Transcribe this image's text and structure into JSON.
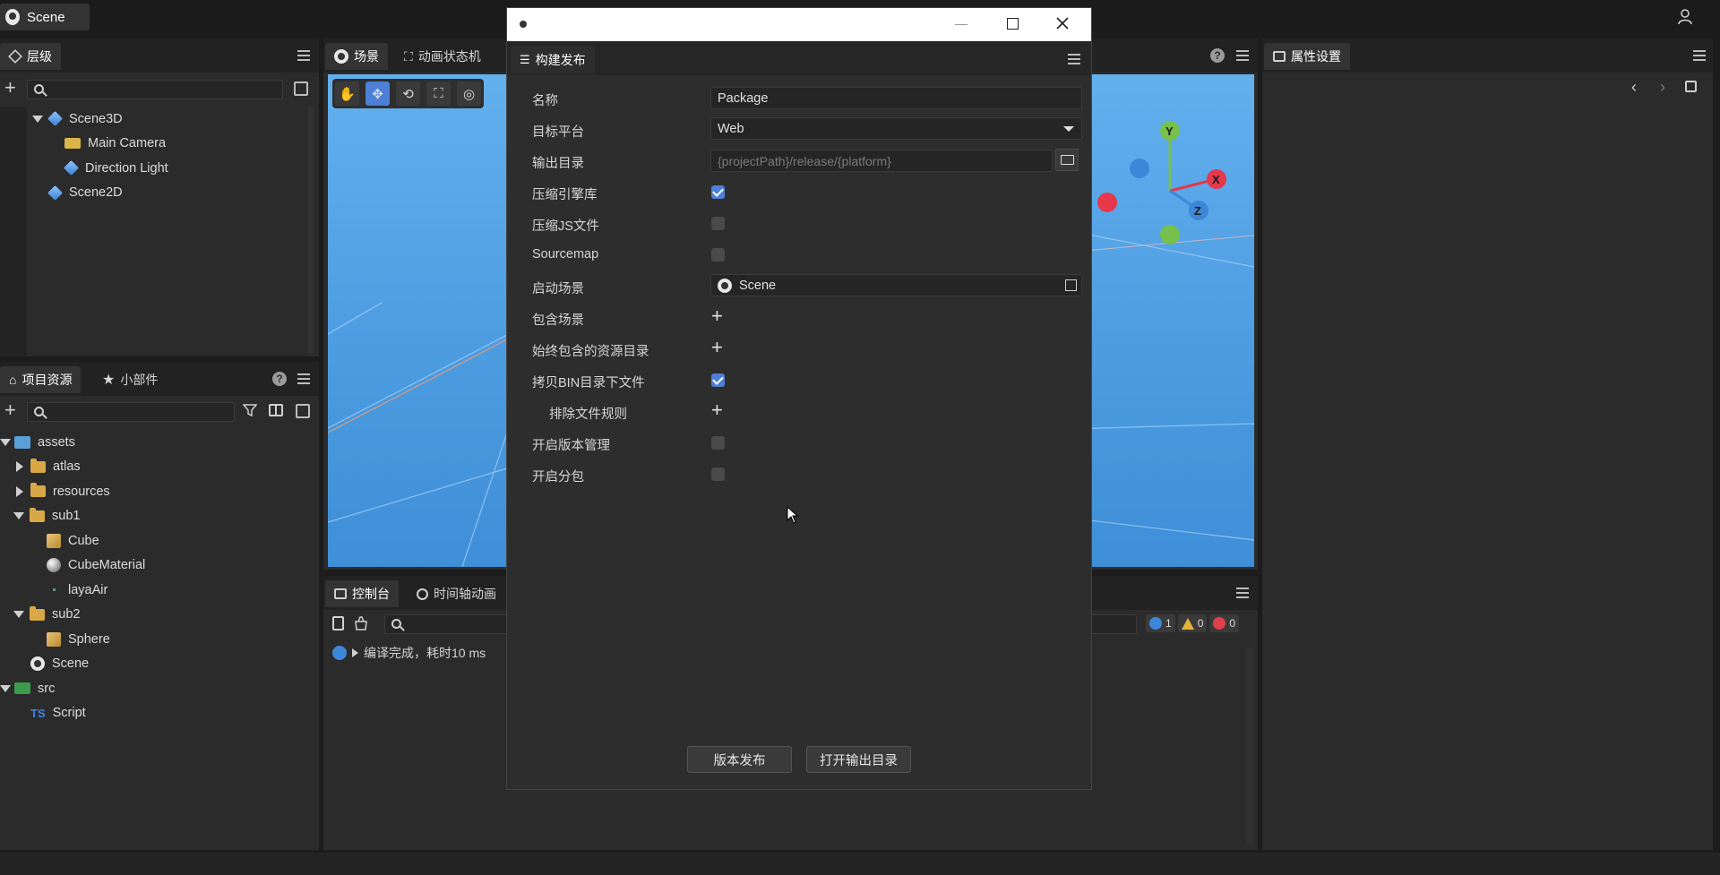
{
  "app": {
    "scene_tab": "Scene"
  },
  "hierarchy": {
    "tab_label": "层级",
    "tree": [
      {
        "label": "Scene3D",
        "icon": "cube-icon"
      },
      {
        "label": "Main Camera",
        "icon": "camera-icon"
      },
      {
        "label": "Direction Light",
        "icon": "cube-icon"
      },
      {
        "label": "Scene2D",
        "icon": "cube-icon"
      }
    ]
  },
  "assets_panel": {
    "tab_project": "项目资源",
    "tab_widgets": "小部件",
    "tree": [
      {
        "label": "assets"
      },
      {
        "label": "atlas"
      },
      {
        "label": "resources"
      },
      {
        "label": "sub1"
      },
      {
        "label": "Cube"
      },
      {
        "label": "CubeMaterial"
      },
      {
        "label": "layaAir"
      },
      {
        "label": "sub2"
      },
      {
        "label": "Sphere"
      },
      {
        "label": "Scene"
      },
      {
        "label": "src"
      },
      {
        "label": "Script",
        "prefix": "TS"
      }
    ]
  },
  "center": {
    "tab_scene": "场景",
    "tab_animator": "动画状态机",
    "gizmo_labels": {
      "y": "Y",
      "x": "X",
      "z": "Z"
    }
  },
  "console": {
    "tab_console": "控制台",
    "tab_timeline": "时间轴动画",
    "message": "编译完成，耗时10 ms",
    "counts": {
      "info": "1",
      "warn": "0",
      "error": "0"
    }
  },
  "properties": {
    "tab_label": "属性设置"
  },
  "dialog": {
    "title_tab": "构建发布",
    "rows": {
      "name_label": "名称",
      "name_value": "Package",
      "platform_label": "目标平台",
      "platform_value": "Web",
      "output_label": "输出目录",
      "output_placeholder": "{projectPath}/release/{platform}",
      "compress_engine_label": "压缩引擎库",
      "compress_js_label": "压缩JS文件",
      "sourcemap_label": "Sourcemap",
      "start_scene_label": "启动场景",
      "start_scene_value": "Scene",
      "include_scenes_label": "包含场景",
      "always_include_label": "始终包含的资源目录",
      "copy_bin_label": "拷贝BIN目录下文件",
      "exclude_rules_label": "排除文件规则",
      "version_mgmt_label": "开启版本管理",
      "subpackage_label": "开启分包"
    },
    "checks": {
      "compress_engine": true,
      "compress_js": false,
      "sourcemap": false,
      "copy_bin": true,
      "version_mgmt": false,
      "subpackage": false
    },
    "buttons": {
      "publish": "版本发布",
      "open_output": "打开输出目录"
    }
  },
  "colors": {
    "accent": "#4d7fd6",
    "sky": "#5aa8ea"
  }
}
